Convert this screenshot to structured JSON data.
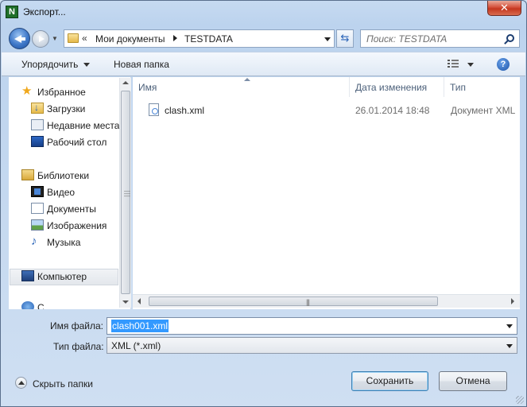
{
  "window": {
    "title": "Экспорт...",
    "close_symbol": "✕",
    "app_icon_letter": "N"
  },
  "address": {
    "overflow_chevron": "«",
    "crumbs": [
      "Мои документы",
      "TESTDATA"
    ],
    "refresh_symbol": "⇆"
  },
  "search": {
    "placeholder": "Поиск: TESTDATA"
  },
  "toolbar": {
    "organize_label": "Упорядочить",
    "new_folder_label": "Новая папка",
    "help_symbol": "?"
  },
  "nav": {
    "items": [
      {
        "label": "Избранное",
        "icon": "star-icon"
      },
      {
        "label": "Загрузки",
        "icon": "downloads-folder-icon"
      },
      {
        "label": "Недавние места",
        "icon": "recent-places-icon"
      },
      {
        "label": "Рабочий стол",
        "icon": "desktop-icon"
      },
      {
        "label": "Библиотеки",
        "icon": "libraries-icon"
      },
      {
        "label": "Видео",
        "icon": "video-icon"
      },
      {
        "label": "Документы",
        "icon": "documents-icon"
      },
      {
        "label": "Изображения",
        "icon": "pictures-icon"
      },
      {
        "label": "Музыка",
        "icon": "music-icon"
      },
      {
        "label": "Компьютер",
        "icon": "computer-icon"
      },
      {
        "label": "С",
        "icon": "network-icon"
      }
    ]
  },
  "filelist": {
    "columns": [
      "Имя",
      "Дата изменения",
      "Тип"
    ],
    "files": [
      {
        "name": "clash.xml",
        "date": "26.01.2014 18:48",
        "type": "Документ XML"
      }
    ]
  },
  "form": {
    "filename_label": "Имя файла:",
    "filename_value": "clash001.xml",
    "filetype_label": "Тип файла:",
    "filetype_value": "XML (*.xml)"
  },
  "footer": {
    "hide_folders_label": "Скрыть папки",
    "save_label": "Сохранить",
    "cancel_label": "Отмена"
  },
  "colors": {
    "selection": "#3399ff",
    "close_button": "#c4371f",
    "frame": "#c6daf1"
  }
}
